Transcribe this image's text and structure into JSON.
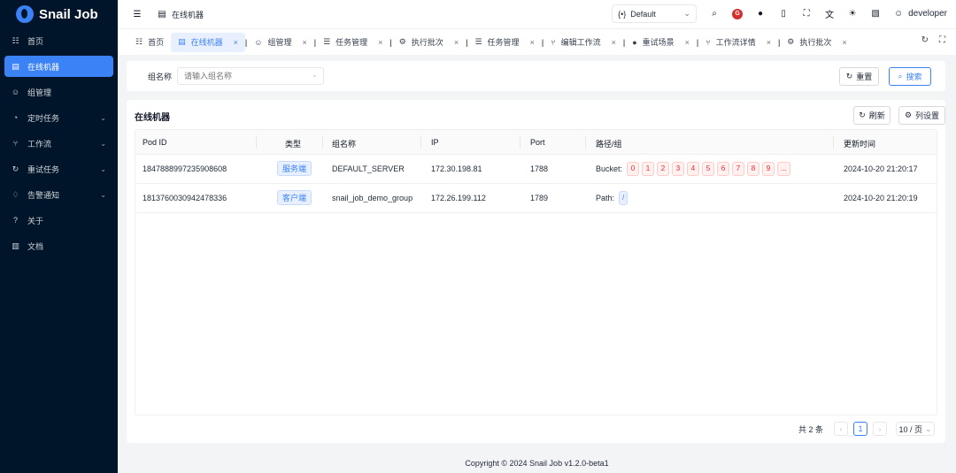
{
  "app": {
    "logo_text": "Snail Job"
  },
  "sidebar": {
    "items": [
      {
        "icon": "☷",
        "icon_name": "dashboard-icon",
        "label": "首页",
        "chevron": false,
        "active": false
      },
      {
        "icon": "▤",
        "icon_name": "machine-icon",
        "label": "在线机器",
        "chevron": false,
        "active": true
      },
      {
        "icon": "☺",
        "icon_name": "group-icon",
        "label": "组管理",
        "chevron": false,
        "active": false
      },
      {
        "icon": "◔",
        "icon_name": "clock-icon",
        "label": "定时任务",
        "chevron": true,
        "active": false
      },
      {
        "icon": "⑂",
        "icon_name": "workflow-icon",
        "label": "工作流",
        "chevron": true,
        "active": false
      },
      {
        "icon": "↻",
        "icon_name": "retry-icon",
        "label": "重试任务",
        "chevron": true,
        "active": false
      },
      {
        "icon": "♢",
        "icon_name": "alarm-icon",
        "label": "告警通知",
        "chevron": true,
        "active": false
      },
      {
        "icon": "?",
        "icon_name": "about-icon",
        "label": "关于",
        "chevron": false,
        "active": false
      },
      {
        "icon": "▥",
        "icon_name": "docs-icon",
        "label": "文档",
        "chevron": false,
        "active": false
      }
    ]
  },
  "header": {
    "breadcrumb": "在线机器",
    "theme_select": "Default",
    "user": "developer"
  },
  "tabs": [
    {
      "label": "首页",
      "icon": "☷",
      "closable": false,
      "active": false
    },
    {
      "label": "在线机器",
      "icon": "▤",
      "closable": true,
      "active": true
    },
    {
      "label": "组管理",
      "icon": "☺",
      "closable": true,
      "active": false
    },
    {
      "label": "任务管理",
      "icon": "☰",
      "closable": true,
      "active": false
    },
    {
      "label": "执行批次",
      "icon": "⚙",
      "closable": true,
      "active": false
    },
    {
      "label": "任务管理",
      "icon": "☰",
      "closable": true,
      "active": false
    },
    {
      "label": "编辑工作流",
      "icon": "⑂",
      "closable": true,
      "active": false
    },
    {
      "label": "重试场景",
      "icon": "●",
      "closable": true,
      "active": false
    },
    {
      "label": "工作流详情",
      "icon": "⑂",
      "closable": true,
      "active": false
    },
    {
      "label": "执行批次",
      "icon": "⚙",
      "closable": true,
      "active": false
    }
  ],
  "search": {
    "label": "组名称",
    "placeholder": "请输入组名称",
    "reset_label": "重置",
    "search_label": "搜索"
  },
  "table_card": {
    "title": "在线机器",
    "refresh_label": "刷新",
    "columns_label": "列设置",
    "headers": [
      "Pod ID",
      "类型",
      "组名称",
      "IP",
      "Port",
      "路径/组",
      "更新时间"
    ],
    "rows": [
      {
        "pod_id": "1847888997235908608",
        "type": "服务端",
        "group": "DEFAULT_SERVER",
        "ip": "172.30.198.81",
        "port": "1788",
        "path_label": "Bucket:",
        "path_tags": [
          "0",
          "1",
          "2",
          "3",
          "4",
          "5",
          "6",
          "7",
          "8",
          "9",
          "..."
        ],
        "updated": "2024-10-20 21:20:17"
      },
      {
        "pod_id": "1813760030942478336",
        "type": "客户端",
        "group": "snail_job_demo_group",
        "ip": "172.26.199.112",
        "port": "1789",
        "path_label": "Path:",
        "path_tags": [
          "/"
        ],
        "updated": "2024-10-20 21:20:19"
      }
    ]
  },
  "pagination": {
    "total_text": "共 2 条",
    "current_page": "1",
    "page_size": "10 / 页"
  },
  "footer": {
    "copyright": "Copyright © 2024 Snail Job v1.2.0-beta1"
  },
  "colors": {
    "primary": "#3b82f6",
    "sidebar_bg": "#001529",
    "danger": "#f5222d"
  }
}
